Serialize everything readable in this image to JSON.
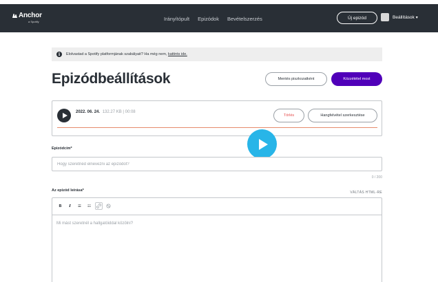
{
  "navbar": {
    "logo_text": "Anchor",
    "logo_sub": "a Spotify",
    "links": [
      "Irányítópult",
      "Epizódok",
      "Bevételszerzés"
    ],
    "new_episode_label": "Új epizód",
    "settings_label": "Beállítások"
  },
  "notice": {
    "text": "Elolvastad a Spotify platformjának szabályait? Ha még nem,",
    "link_text": "kattints ide."
  },
  "page": {
    "title": "Epizódbeállítások",
    "save_draft_label": "Mentés piszkozatként",
    "publish_label": "Közzététel most"
  },
  "audio": {
    "date": "2022. 06. 24.",
    "info": "132.27 KB | 00:08",
    "delete_label": "Törlés",
    "edit_label": "Hangfelvétel szerkesztése",
    "progress": 1.0
  },
  "form": {
    "title_label": "Epizódcím*",
    "title_placeholder": "Hogy szeretnéd elnevezni az epizódot?",
    "title_value": "",
    "char_count": "0 / 200",
    "description_label": "Az epizód leírása*",
    "html_switch_label": "VÁLTÁS HTML-RE",
    "description_placeholder": "Mi mást szeretnél a hallgatóiddal közölni?"
  },
  "toolbar": {
    "bold": "B",
    "italic": "I",
    "bullet_list": "☰",
    "numbered_list": "☷",
    "link": "🔗",
    "unlink": "⊘"
  },
  "colors": {
    "navbar_bg": "#292f36",
    "publish_purple": "#5000b9",
    "delete_red": "#e54b4b",
    "progress_orange": "#e58b6c",
    "video_play_blue": "#28b5e8"
  }
}
